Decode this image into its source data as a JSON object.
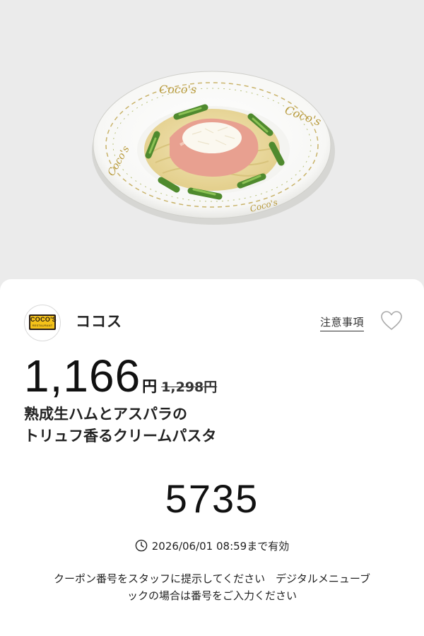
{
  "brand": {
    "logo_text": "COCO'S",
    "logo_subtext": "RESTAURANT",
    "name": "ココス",
    "logo_color": "#f4c21a"
  },
  "header": {
    "notice_label": "注意事項",
    "favorite_icon": "heart-outline-icon"
  },
  "price": {
    "current": "1,166",
    "currency": "円",
    "original": "1,298円"
  },
  "item": {
    "name_line1": "熟成生ハムとアスパラの",
    "name_line2": "トリュフ香るクリームパスタ"
  },
  "coupon": {
    "code": "5735",
    "expiry": "2026/06/01 08:59まで有効",
    "expiry_icon": "clock-icon"
  },
  "instructions": {
    "line1": "クーポン番号をスタッフに提示してください　デジタルメニューブ",
    "line2": "ックの場合は番号をご入力ください"
  },
  "colors": {
    "background": "#ebebeb",
    "card": "#ffffff",
    "text": "#222222"
  }
}
